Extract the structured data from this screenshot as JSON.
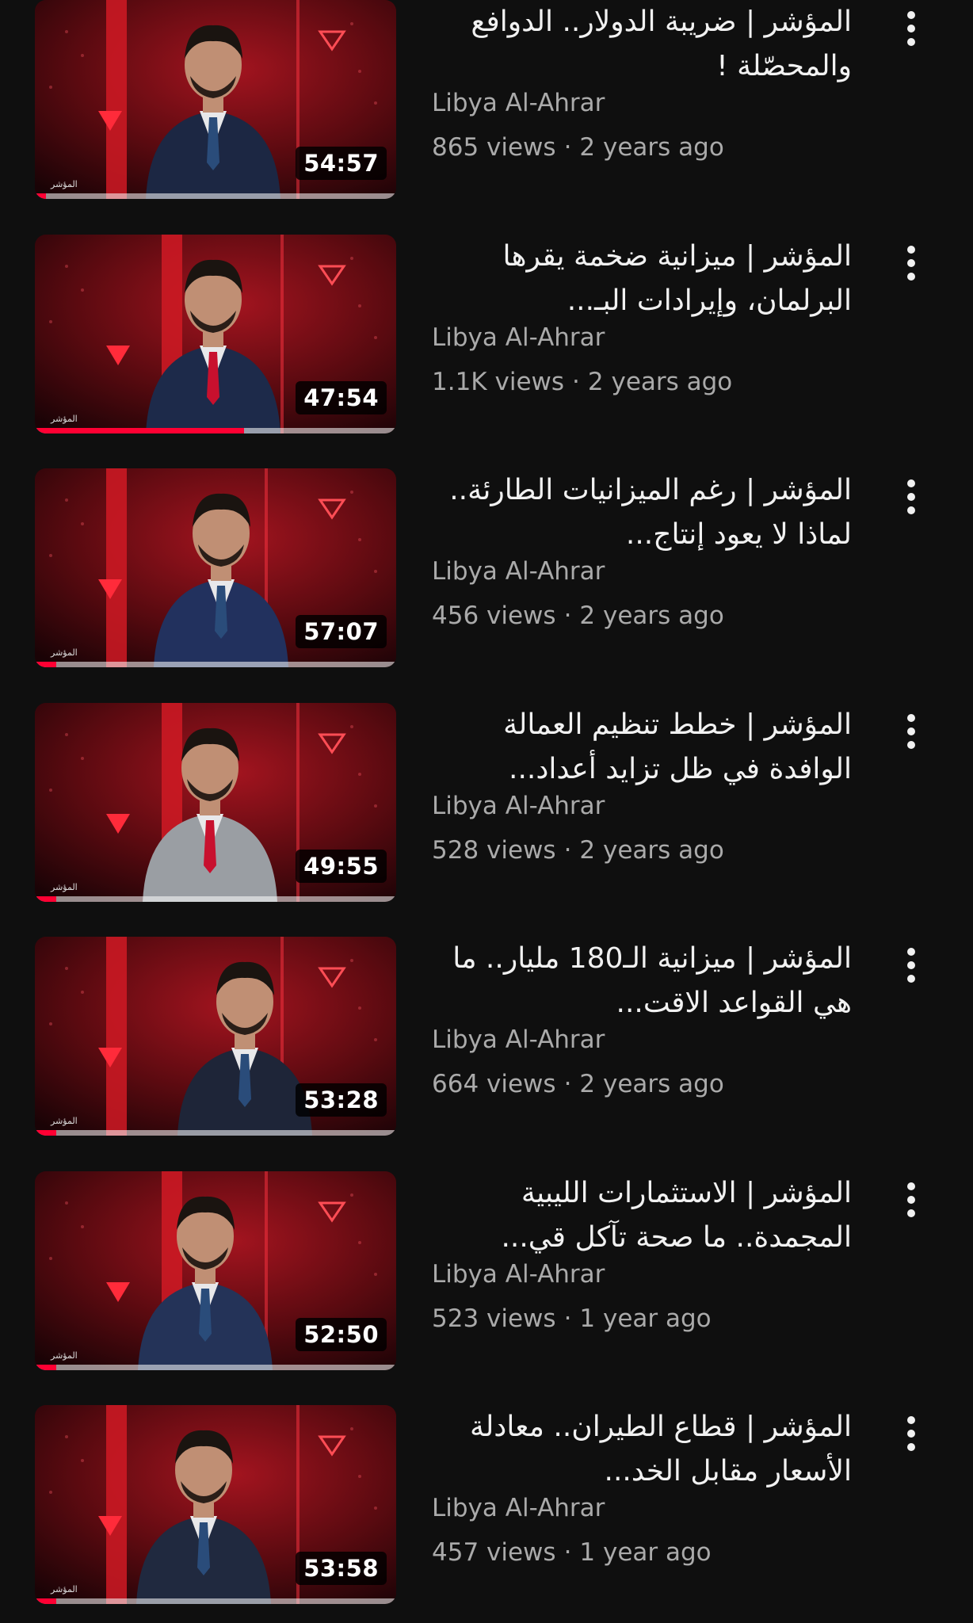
{
  "colors": {
    "background": "#0f0f0f",
    "title": "#f1f1f1",
    "secondary": "#aaaaaa",
    "progress": "#ff0033"
  },
  "videos": [
    {
      "title": "المؤشر | ضريبة الدولار.. الدوافع والمحصّلة !",
      "channel": "Libya Al-Ahrar",
      "views": "865 views",
      "age": "2 years ago",
      "duration": "54:57",
      "watched_fraction": 0.03
    },
    {
      "title": "المؤشر | ميزانية ضخمة يقرها البرلمان، وإيرادات البـ...",
      "channel": "Libya Al-Ahrar",
      "views": "1.1K views",
      "age": "2 years ago",
      "duration": "47:54",
      "watched_fraction": 0.58
    },
    {
      "title": "المؤشر | رغم الميزانيات الطارئة.. لماذا لا يعود إنتاج...",
      "channel": "Libya Al-Ahrar",
      "views": "456 views",
      "age": "2 years ago",
      "duration": "57:07",
      "watched_fraction": 0.06
    },
    {
      "title": "المؤشر | خطط تنظيم العمالة الوافدة في ظل تزايد أعداد...",
      "channel": "Libya Al-Ahrar",
      "views": "528 views",
      "age": "2 years ago",
      "duration": "49:55",
      "watched_fraction": 0.06
    },
    {
      "title": "المؤشر | ميزانية الـ180 مليار.. ما هي القواعد الاقت...",
      "channel": "Libya Al-Ahrar",
      "views": "664 views",
      "age": "2 years ago",
      "duration": "53:28",
      "watched_fraction": 0.06
    },
    {
      "title": "المؤشر | الاستثمارات الليبية المجمدة.. ما صحة تآكل قي...",
      "channel": "Libya Al-Ahrar",
      "views": "523 views",
      "age": "1 year ago",
      "duration": "52:50",
      "watched_fraction": 0.06
    },
    {
      "title": "المؤشر | قطاع الطيران.. معادلة الأسعار مقابل الخد...",
      "channel": "Libya Al-Ahrar",
      "views": "457 views",
      "age": "1 year ago",
      "duration": "53:58",
      "watched_fraction": 0.06
    }
  ],
  "icons": {
    "menu": "more-vert-icon"
  },
  "separator": "·"
}
